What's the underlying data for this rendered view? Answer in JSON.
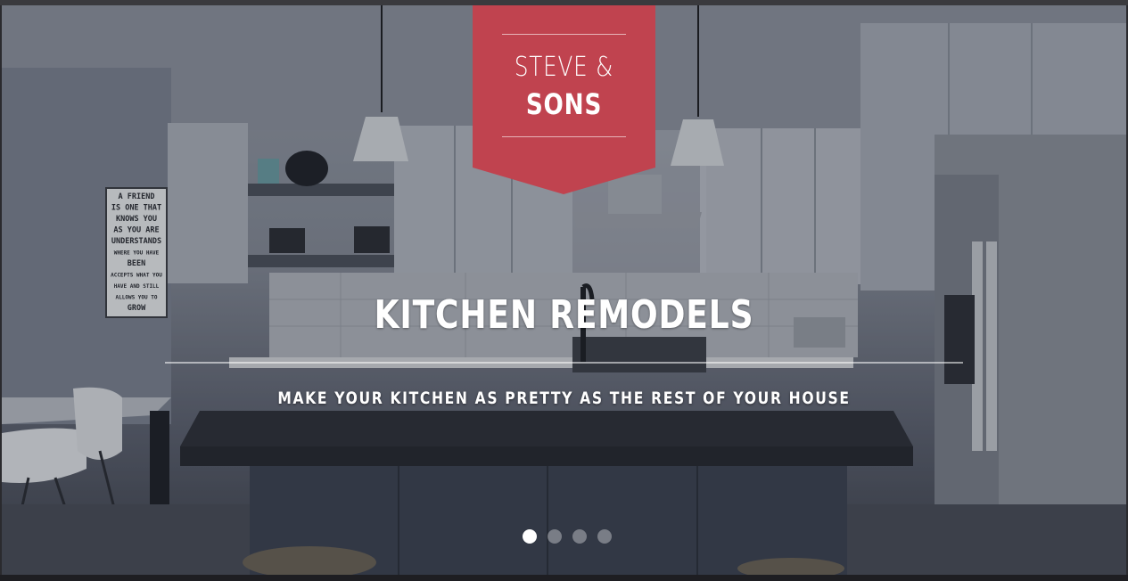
{
  "brand": {
    "line1": "STEVE &",
    "line2": "SONS",
    "color": "#c0434f"
  },
  "slide": {
    "headline": "KITCHEN REMODELS",
    "subline": "MAKE YOUR KITCHEN AS PRETTY AS THE REST OF YOUR HOUSE",
    "background": "kitchen-photo"
  },
  "wall_sign": {
    "lines": [
      "A FRIEND",
      "IS ONE THAT",
      "KNOWS YOU",
      "AS YOU ARE",
      "UNDERSTANDS",
      "WHERE YOU HAVE",
      "BEEN",
      "ACCEPTS WHAT YOU",
      "HAVE AND STILL",
      "ALLOWS YOU TO",
      "GROW"
    ]
  },
  "carousel": {
    "total": 4,
    "active": 1
  }
}
